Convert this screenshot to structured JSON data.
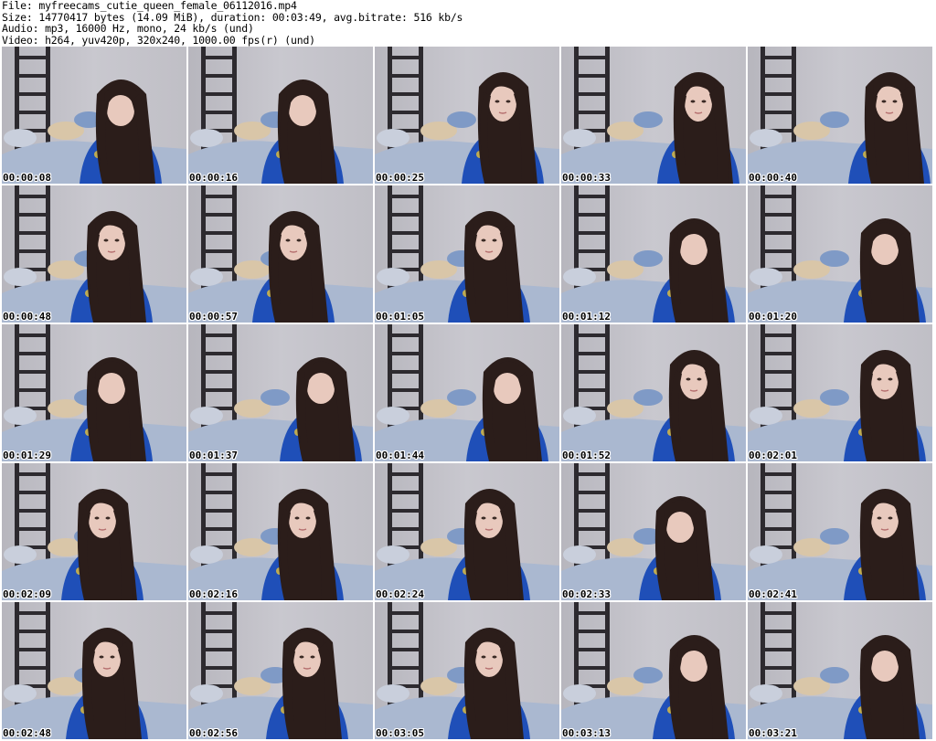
{
  "header": {
    "file_line": "File: myfreecams_cutie_queen_female_06112016.mp4",
    "size_line": "Size: 14770417 bytes (14.09 MiB), duration: 00:03:49, avg.bitrate: 516 kb/s",
    "audio_line": "Audio: mp3, 16000 Hz, mono, 24 kb/s (und)",
    "video_line": "Video: h264, yuv420p, 320x240, 1000.00 fps(r) (und)"
  },
  "thumbnails": [
    {
      "timestamp": "00:00:08",
      "pose": "down",
      "shift": -10
    },
    {
      "timestamp": "00:00:16",
      "pose": "down",
      "shift": -15
    },
    {
      "timestamp": "00:00:25",
      "pose": "front",
      "shift": 0
    },
    {
      "timestamp": "00:00:33",
      "pose": "front",
      "shift": 10
    },
    {
      "timestamp": "00:00:40",
      "pose": "front",
      "shift": 15
    },
    {
      "timestamp": "00:00:48",
      "pose": "front",
      "shift": -20
    },
    {
      "timestamp": "00:00:57",
      "pose": "front",
      "shift": -25
    },
    {
      "timestamp": "00:01:05",
      "pose": "front",
      "shift": -15
    },
    {
      "timestamp": "00:01:12",
      "pose": "down",
      "shift": 5
    },
    {
      "timestamp": "00:01:20",
      "pose": "down",
      "shift": 10
    },
    {
      "timestamp": "00:01:29",
      "pose": "down",
      "shift": -20
    },
    {
      "timestamp": "00:01:37",
      "pose": "down",
      "shift": 5
    },
    {
      "timestamp": "00:01:44",
      "pose": "down",
      "shift": 5
    },
    {
      "timestamp": "00:01:52",
      "pose": "front",
      "shift": 5
    },
    {
      "timestamp": "00:02:01",
      "pose": "front",
      "shift": 10
    },
    {
      "timestamp": "00:02:09",
      "pose": "front",
      "shift": -30
    },
    {
      "timestamp": "00:02:16",
      "pose": "front",
      "shift": -15
    },
    {
      "timestamp": "00:02:24",
      "pose": "front",
      "shift": -15
    },
    {
      "timestamp": "00:02:33",
      "pose": "down",
      "shift": -10
    },
    {
      "timestamp": "00:02:41",
      "pose": "front",
      "shift": 10
    },
    {
      "timestamp": "00:02:48",
      "pose": "front",
      "shift": -25
    },
    {
      "timestamp": "00:02:56",
      "pose": "front",
      "shift": -10
    },
    {
      "timestamp": "00:03:05",
      "pose": "front",
      "shift": -15
    },
    {
      "timestamp": "00:03:13",
      "pose": "down",
      "shift": 5
    },
    {
      "timestamp": "00:03:21",
      "pose": "down",
      "shift": 10
    }
  ],
  "colors": {
    "wall": "#c4c3ca",
    "ladder": "#2d2a2f",
    "hair": "#2b1d1a",
    "skin": "#e8c9bd",
    "shirt": "#1f4fb8",
    "bed": "#aab8d0"
  }
}
